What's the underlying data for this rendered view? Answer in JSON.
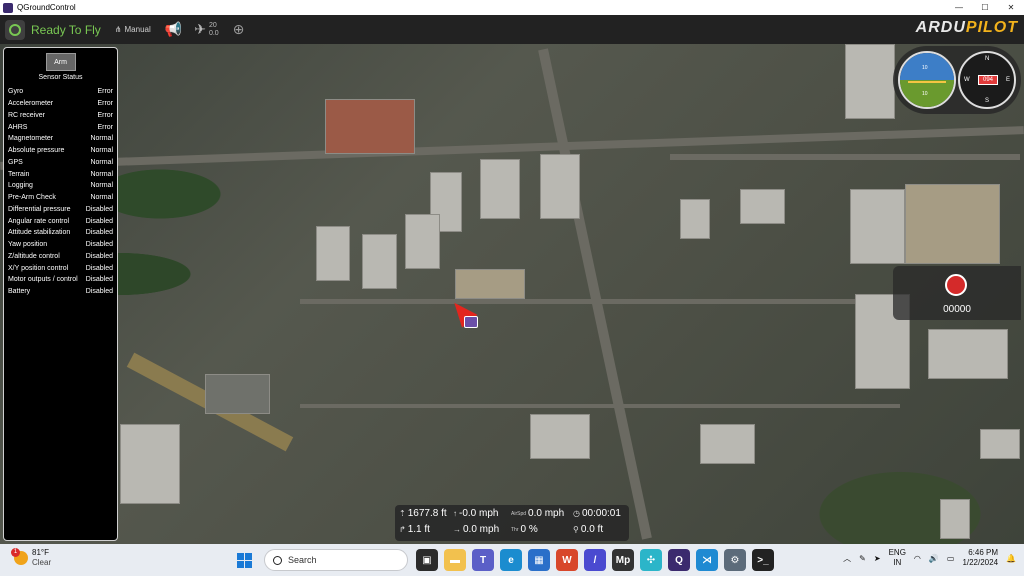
{
  "window": {
    "title": "QGroundControl",
    "minimize": "—",
    "maximize": "☐",
    "close": "✕"
  },
  "toolbar": {
    "status": "Ready To Fly",
    "flight_mode": "Manual",
    "satellites": "20",
    "hdop": "0.0",
    "brand_ardu": "ARDU",
    "brand_pilot": "PILOT"
  },
  "sensor_panel": {
    "arm_label": "Arm",
    "title": "Sensor Status",
    "sensors": [
      {
        "name": "Gyro",
        "status": "Error"
      },
      {
        "name": "Accelerometer",
        "status": "Error"
      },
      {
        "name": "RC receiver",
        "status": "Error"
      },
      {
        "name": "AHRS",
        "status": "Error"
      },
      {
        "name": "Magnetometer",
        "status": "Normal"
      },
      {
        "name": "Absolute pressure",
        "status": "Normal"
      },
      {
        "name": "GPS",
        "status": "Normal"
      },
      {
        "name": "Terrain",
        "status": "Normal"
      },
      {
        "name": "Logging",
        "status": "Normal"
      },
      {
        "name": "Pre-Arm Check",
        "status": "Normal"
      },
      {
        "name": "Differential pressure",
        "status": "Disabled"
      },
      {
        "name": "Angular rate control",
        "status": "Disabled"
      },
      {
        "name": "Attitude stabilization",
        "status": "Disabled"
      },
      {
        "name": "Yaw position",
        "status": "Disabled"
      },
      {
        "name": "Z/altitude control",
        "status": "Disabled"
      },
      {
        "name": "X/Y position control",
        "status": "Disabled"
      },
      {
        "name": "Motor outputs / control",
        "status": "Disabled"
      },
      {
        "name": "Battery",
        "status": "Disabled"
      }
    ]
  },
  "instruments": {
    "pitch_up": "10",
    "pitch_down": "10",
    "compass_n": "N",
    "compass_s": "S",
    "compass_e": "E",
    "compass_w": "W",
    "heading": "094"
  },
  "record": {
    "time": "00000"
  },
  "telemetry": {
    "altitude": "1677.8 ft",
    "climb_rate": "-0.0 mph",
    "airspeed_label": "AirSpd",
    "airspeed": "0.0 mph",
    "flight_time": "00:00:01",
    "alt_rel": "1.1 ft",
    "ground_speed": "0.0 mph",
    "throttle_label": "Thr",
    "throttle": "0 %",
    "distance": "0.0 ft"
  },
  "taskbar": {
    "weather_badge": "1",
    "temperature": "81°F",
    "condition": "Clear",
    "search_placeholder": "Search",
    "lang_top": "ENG",
    "lang_bottom": "IN",
    "time": "6:46 PM",
    "date": "1/22/2024",
    "apps": [
      {
        "name": "files",
        "label": "▣",
        "color": "#2b2b2b"
      },
      {
        "name": "explorer",
        "label": "▬",
        "color": "#f2c14e"
      },
      {
        "name": "teams",
        "label": "T",
        "color": "#5b5fc7"
      },
      {
        "name": "edge",
        "label": "e",
        "color": "#1b8ccf"
      },
      {
        "name": "store",
        "label": "▦",
        "color": "#2a6fc9"
      },
      {
        "name": "office",
        "label": "W",
        "color": "#d8472b"
      },
      {
        "name": "pen",
        "label": "/",
        "color": "#4a4ad0"
      },
      {
        "name": "mp",
        "label": "Mp",
        "color": "#333333"
      },
      {
        "name": "network",
        "label": "✣",
        "color": "#2bb5c9"
      },
      {
        "name": "qgc",
        "label": "Q",
        "color": "#3b2a6e"
      },
      {
        "name": "vscode",
        "label": "⋊",
        "color": "#1f8ad2"
      },
      {
        "name": "settings",
        "label": "⚙",
        "color": "#5c6b7a"
      },
      {
        "name": "terminal",
        "label": ">_",
        "color": "#222222"
      }
    ]
  }
}
